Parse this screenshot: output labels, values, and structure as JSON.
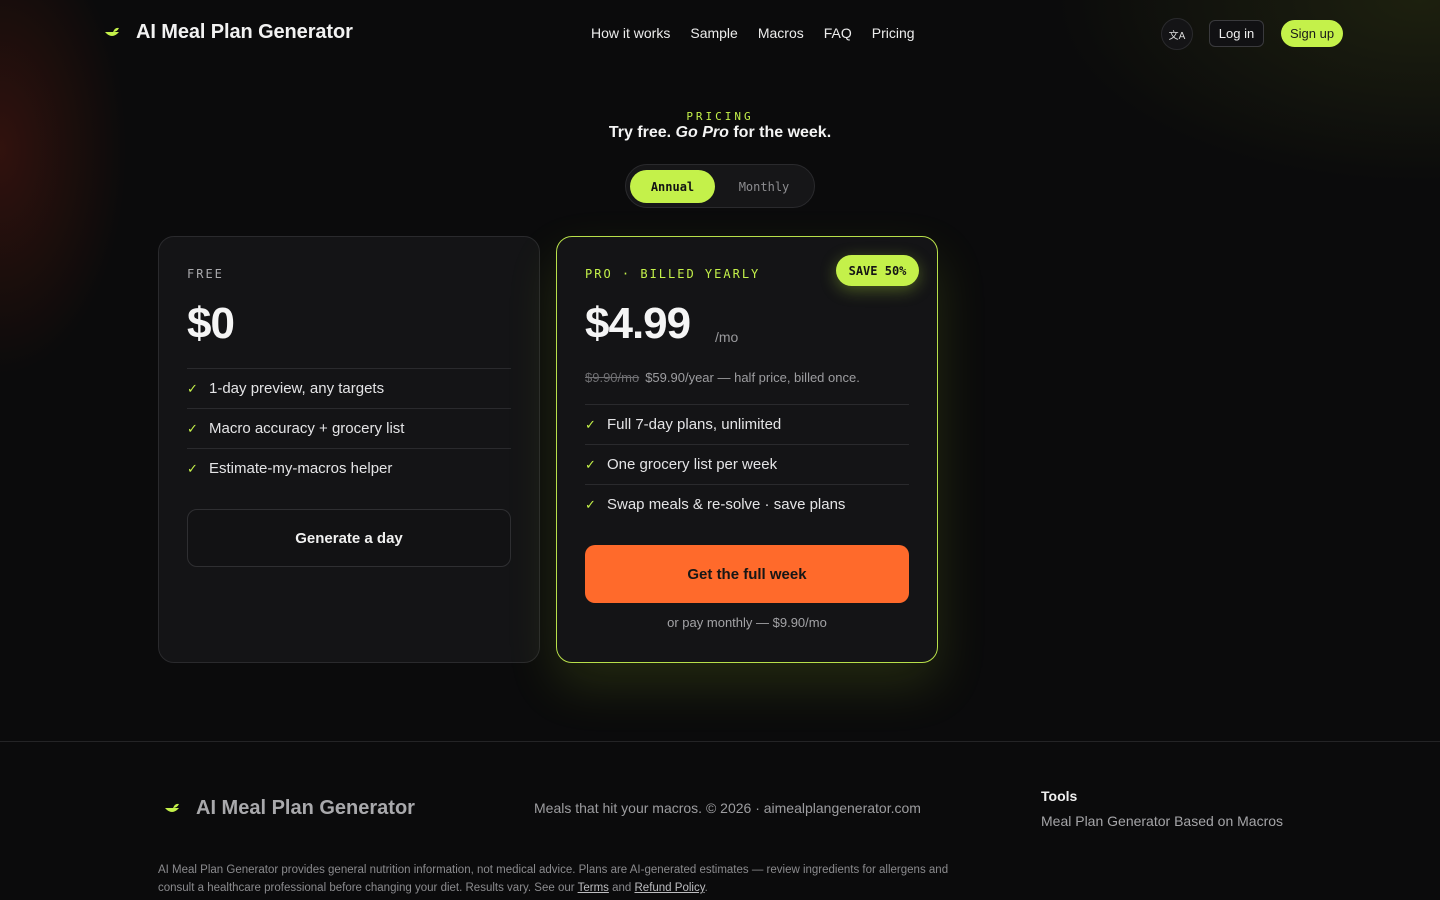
{
  "header": {
    "brand": "AI Meal Plan Generator",
    "logo_icon": "leaf-bowl-icon",
    "nav": [
      "How it works",
      "Sample",
      "Macros",
      "FAQ",
      "Pricing"
    ],
    "lang_icon": "translate-icon",
    "lang_glyph": "文A",
    "login": "Log in",
    "signup": "Sign up"
  },
  "pricing": {
    "eyebrow": "PRICING",
    "headline_prefix": "Try free.",
    "headline_emph": "Go Pro",
    "headline_suffix": "for the week.",
    "toggle": {
      "annual": "Annual",
      "monthly": "Monthly",
      "selected": "Annual"
    }
  },
  "free_plan": {
    "label": "FREE",
    "price": "$0",
    "features": [
      "1-day preview, any targets",
      "Macro accuracy + grocery list",
      "Estimate-my-macros helper"
    ],
    "cta": "Generate a day"
  },
  "pro_plan": {
    "label": "PRO · BILLED YEARLY",
    "badge": "SAVE 50%",
    "price": "$4.99",
    "per": "/mo",
    "old_price": "$9.90/mo",
    "price_note": "$59.90/year — half price, billed once.",
    "features": [
      "Full 7-day plans, unlimited",
      "One grocery list per week",
      "Swap meals & re-solve · save plans"
    ],
    "cta": "Get the full week",
    "monthly_note": "or pay monthly — $9.90/mo"
  },
  "footer": {
    "brand": "AI Meal Plan Generator",
    "tagline": "Meals that hit your macros. © 2026 · aimealplangenerator.com",
    "tools_title": "Tools",
    "tools_link": "Meal Plan Generator Based on Macros",
    "disclaimer_text": "AI Meal Plan Generator provides general nutrition information, not medical advice. Plans are AI-generated estimates — review ingredients for allergens and consult a healthcare professional before changing your diet. Results vary. See our",
    "terms": "Terms",
    "and": "and",
    "refund": "Refund Policy",
    "period": "."
  },
  "colors": {
    "accent": "#c4f14a",
    "cta": "#ff6a2b",
    "bg": "#0b0b0c",
    "card": "#141416"
  }
}
